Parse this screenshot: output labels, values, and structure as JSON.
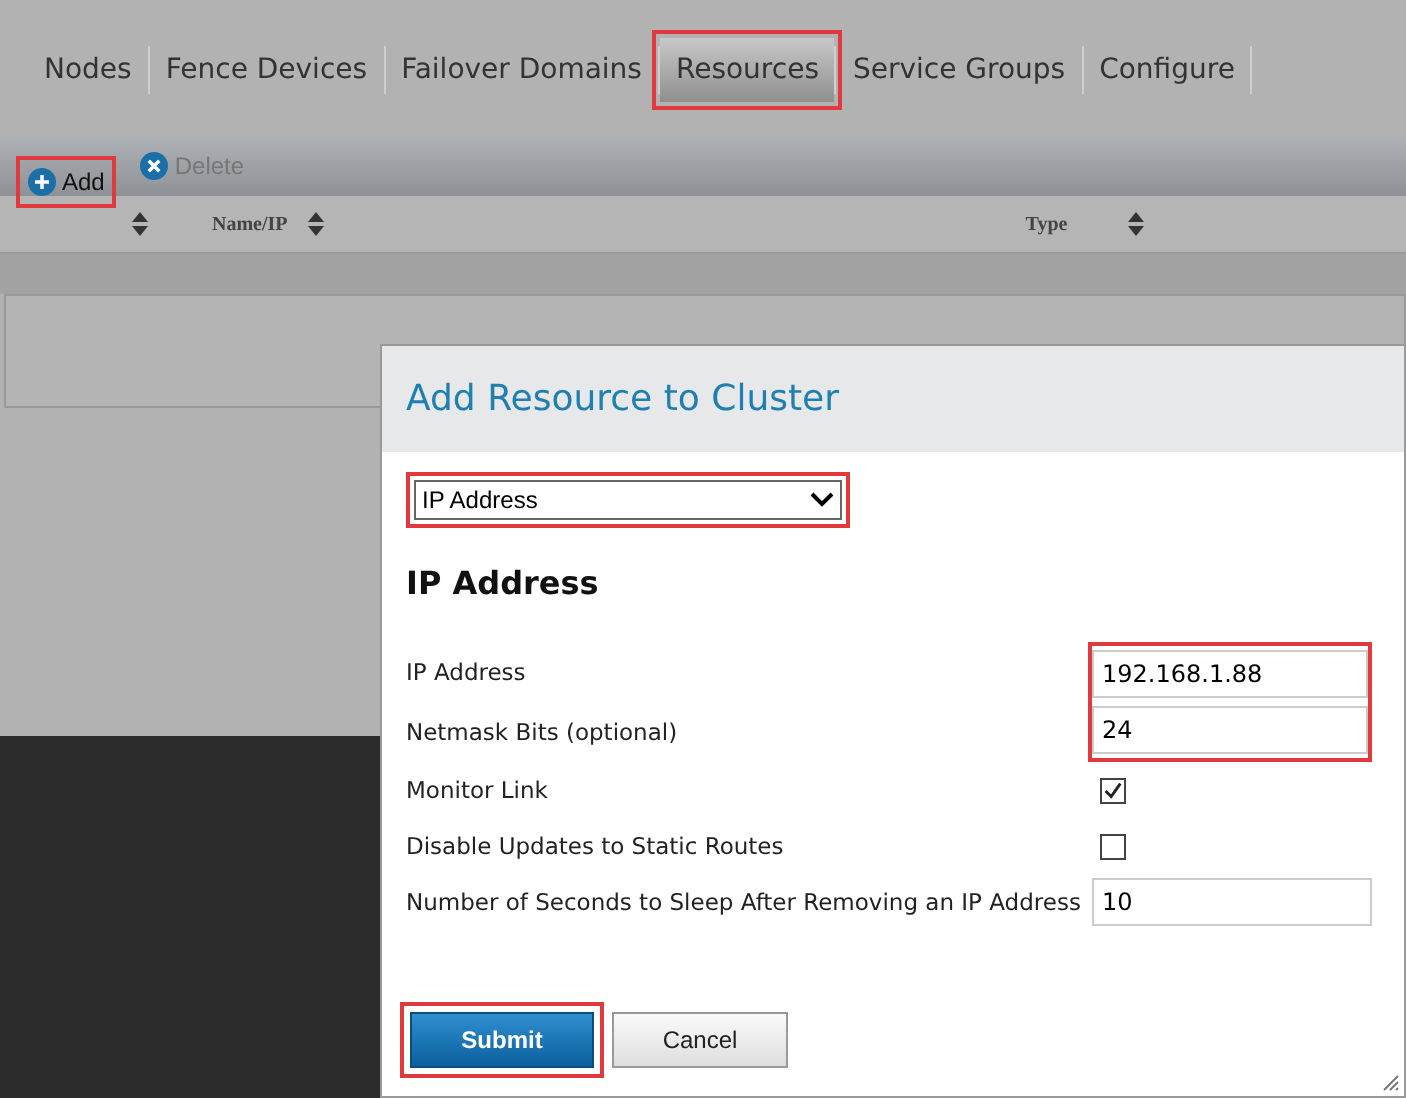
{
  "tabs": [
    {
      "label": "Nodes",
      "selected": false,
      "highlighted": false
    },
    {
      "label": "Fence Devices",
      "selected": false,
      "highlighted": false
    },
    {
      "label": "Failover Domains",
      "selected": false,
      "highlighted": false
    },
    {
      "label": "Resources",
      "selected": true,
      "highlighted": true
    },
    {
      "label": "Service Groups",
      "selected": false,
      "highlighted": false
    },
    {
      "label": "Configure",
      "selected": false,
      "highlighted": false
    }
  ],
  "toolbar": {
    "add": {
      "label": "Add",
      "highlighted": true
    },
    "delete": {
      "label": "Delete",
      "disabled": true
    }
  },
  "table": {
    "columns": [
      "Name/IP",
      "Type"
    ]
  },
  "dialog": {
    "title": "Add Resource to Cluster",
    "resource_type": {
      "value": "IP Address",
      "highlighted": true
    },
    "heading": "IP Address",
    "fields": [
      {
        "kind": "text",
        "label": "IP Address",
        "value": "192.168.1.88",
        "highlighted": true
      },
      {
        "kind": "text",
        "label": "Netmask Bits (optional)",
        "value": "24",
        "highlighted": true
      },
      {
        "kind": "checkbox",
        "label": "Monitor Link",
        "checked": true
      },
      {
        "kind": "checkbox",
        "label": "Disable Updates to Static Routes",
        "checked": false
      },
      {
        "kind": "text",
        "label": "Number of Seconds to Sleep After Removing an IP Address",
        "value": "10",
        "highlighted": false
      }
    ],
    "submit": {
      "label": "Submit",
      "highlighted": true
    },
    "cancel": {
      "label": "Cancel"
    }
  }
}
